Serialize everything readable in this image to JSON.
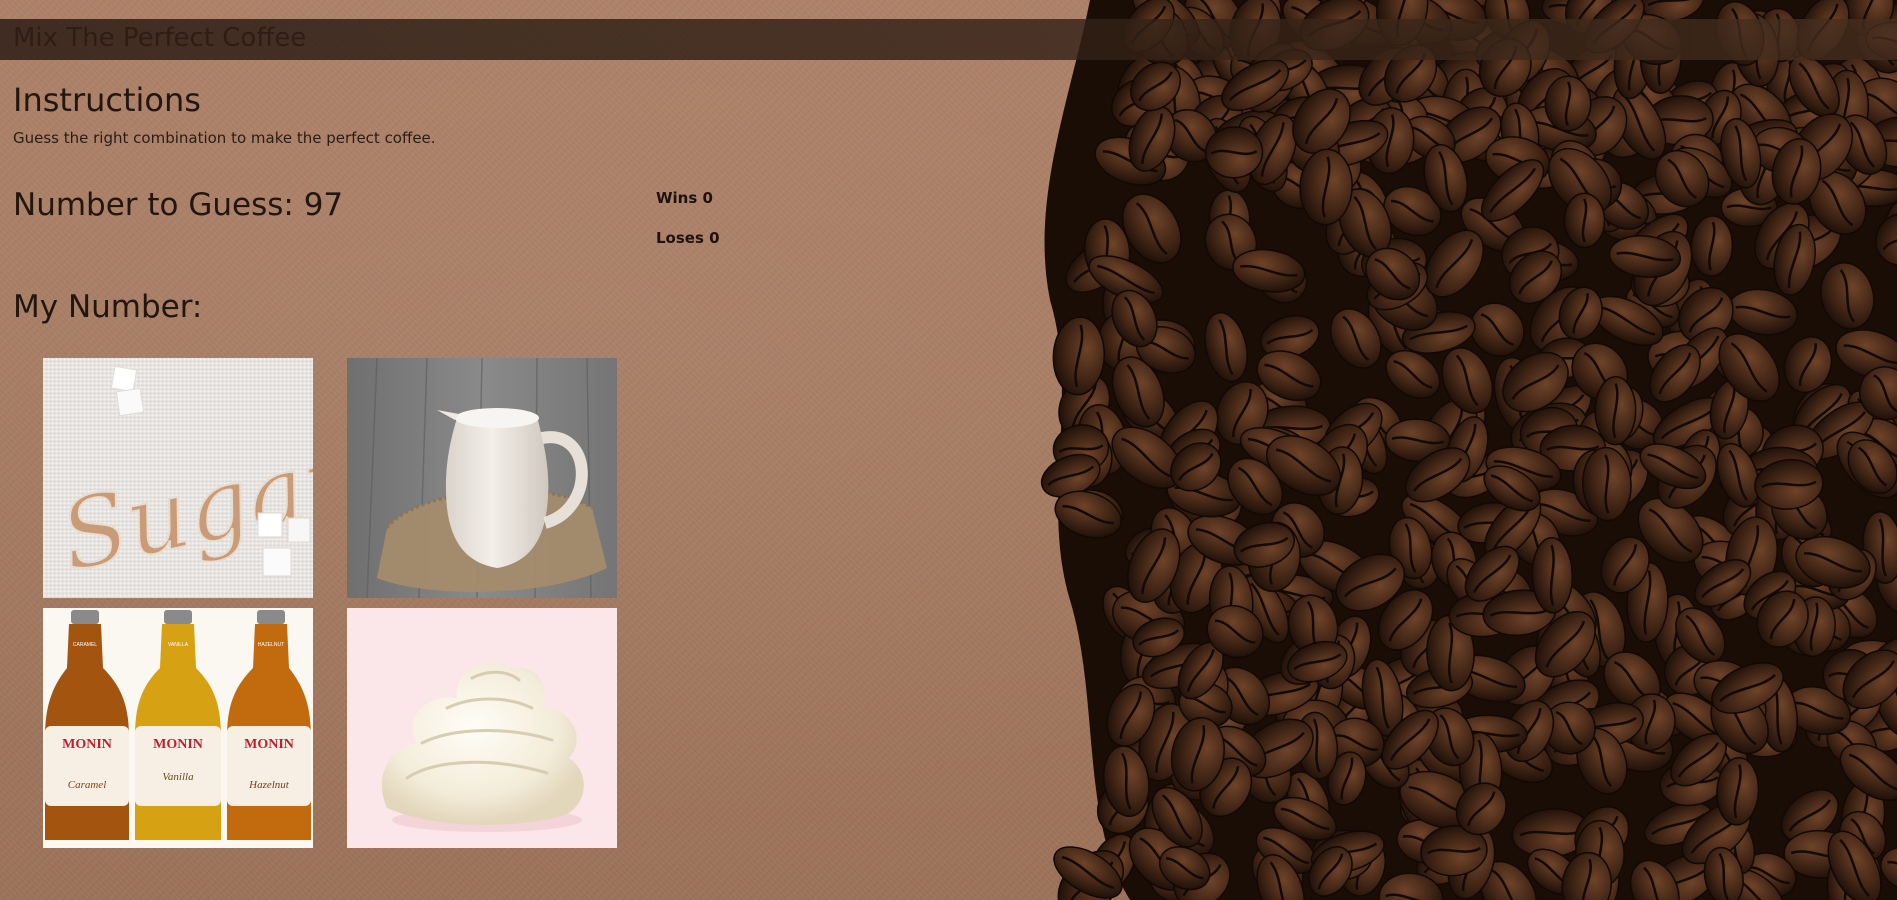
{
  "app": {
    "title": "Mix The Perfect Coffee"
  },
  "instructions": {
    "heading": "Instructions",
    "text": "Guess the right combination to make the perfect coffee."
  },
  "target": {
    "label": "Number to Guess: ",
    "value": "97"
  },
  "score": {
    "wins_label": "Wins ",
    "wins": "0",
    "losses_label": "Loses ",
    "losses": "0"
  },
  "my_number": {
    "label": "My Number:",
    "value": ""
  },
  "ingredients": [
    {
      "name": "sugar",
      "picture_text": "Sugar"
    },
    {
      "name": "milk"
    },
    {
      "name": "syrup",
      "labels": [
        "CARAMEL",
        "VANILLA",
        "HAZELNUT"
      ],
      "brand": "MONIN",
      "flavors": [
        "Caramel",
        "Vanilla",
        "Hazelnut"
      ]
    },
    {
      "name": "whipped-cream"
    }
  ],
  "colors": {
    "background": "#a57a60",
    "header_bar": "#3a261a",
    "text": "#23160f",
    "beans": "#2e1a10"
  }
}
